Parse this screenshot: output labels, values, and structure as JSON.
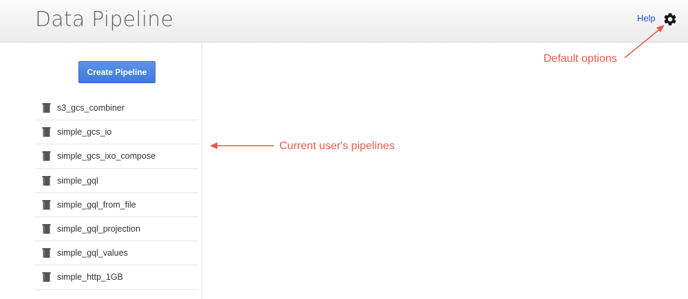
{
  "header": {
    "title": "Data Pipeline",
    "help_label": "Help",
    "settings_icon": "gear-icon"
  },
  "sidebar": {
    "create_button_label": "Create Pipeline",
    "pipeline_icon": "pipe-icon",
    "pipelines": [
      {
        "label": "s3_gcs_combiner"
      },
      {
        "label": "simple_gcs_io"
      },
      {
        "label": "simple_gcs_ixo_compose"
      },
      {
        "label": "simple_gql"
      },
      {
        "label": "simple_gql_from_file"
      },
      {
        "label": "simple_gql_projection"
      },
      {
        "label": "simple_gql_values"
      },
      {
        "label": "simple_http_1GB"
      }
    ]
  },
  "annotations": {
    "default_options": "Default options",
    "current_pipelines": "Current user's pipelines",
    "color": "#e45a48"
  },
  "colors": {
    "accent": "#3f79de",
    "link": "#1f55c8"
  }
}
